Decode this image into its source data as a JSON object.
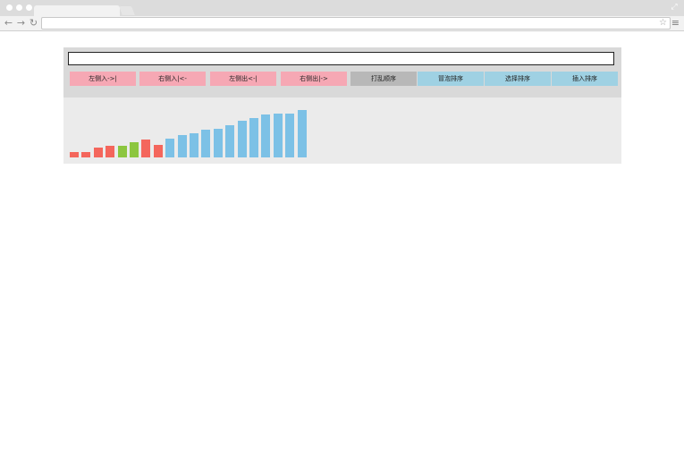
{
  "input": {
    "value": "",
    "placeholder": ""
  },
  "buttons": [
    {
      "label": "左侧入->|",
      "color": "pink"
    },
    {
      "label": "右侧入|<-",
      "color": "pink"
    },
    {
      "label": "左侧出<-|",
      "color": "pink"
    },
    {
      "label": "右侧出|->",
      "color": "pink"
    },
    {
      "label": "打乱顺序",
      "color": "gray"
    },
    {
      "label": "冒泡排序",
      "color": "blue"
    },
    {
      "label": "选择排序",
      "color": "blue"
    },
    {
      "label": "插入排序",
      "color": "blue"
    }
  ],
  "colors": {
    "unsorted": "#f4665c",
    "compare": "#8cc63f",
    "sorted": "#7cc1e6"
  },
  "chart_data": {
    "type": "bar",
    "values": [
      10,
      10,
      19,
      21,
      22,
      29,
      33,
      23,
      35,
      42,
      45,
      51,
      54,
      60,
      69,
      74,
      80,
      82,
      82,
      89
    ],
    "states": [
      "unsorted",
      "unsorted",
      "unsorted",
      "unsorted",
      "compare",
      "compare",
      "unsorted",
      "unsorted",
      "sorted",
      "sorted",
      "sorted",
      "sorted",
      "sorted",
      "sorted",
      "sorted",
      "sorted",
      "sorted",
      "sorted",
      "sorted",
      "sorted"
    ],
    "ylim": [
      0,
      100
    ]
  }
}
